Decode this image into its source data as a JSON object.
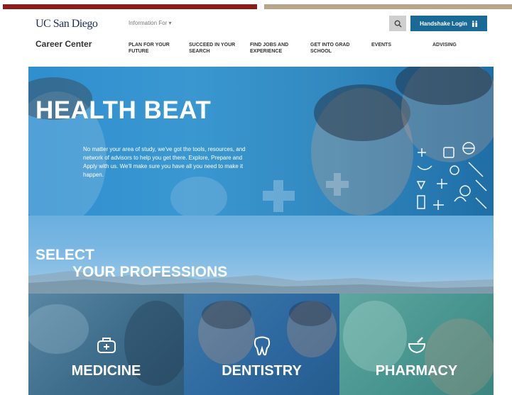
{
  "header": {
    "logo": "UC San Diego",
    "info_for": "Information For ▾",
    "handshake_label": "Handshake Login",
    "site_title": "Career Center",
    "nav": [
      {
        "label": "Plan for your future"
      },
      {
        "label": "Succeed in your search"
      },
      {
        "label": "Find jobs and experience"
      },
      {
        "label": "Get into grad school"
      },
      {
        "label": "Events"
      },
      {
        "label": "Advising"
      }
    ]
  },
  "hero": {
    "title": "HEALTH BEAT",
    "text": "No matter your area of study, we've got the tools, resources, and network of advisors to help you get there. Explore, Prepare and Apply with us. We'll make sure you have all you need to make it happen."
  },
  "select": {
    "line1": "SELECT",
    "line2": "YOUR PROFESSIONS"
  },
  "professions": [
    {
      "label": "MEDICINE",
      "icon": "medical-kit-icon"
    },
    {
      "label": "DENTISTRY",
      "icon": "tooth-icon"
    },
    {
      "label": "PHARMACY",
      "icon": "mortar-pestle-icon"
    }
  ],
  "colors": {
    "brand_red": "#8a1c1c",
    "brand_tan": "#b8a58a",
    "handshake_blue": "#1a6a98",
    "logo_navy": "#1c2f5a"
  }
}
